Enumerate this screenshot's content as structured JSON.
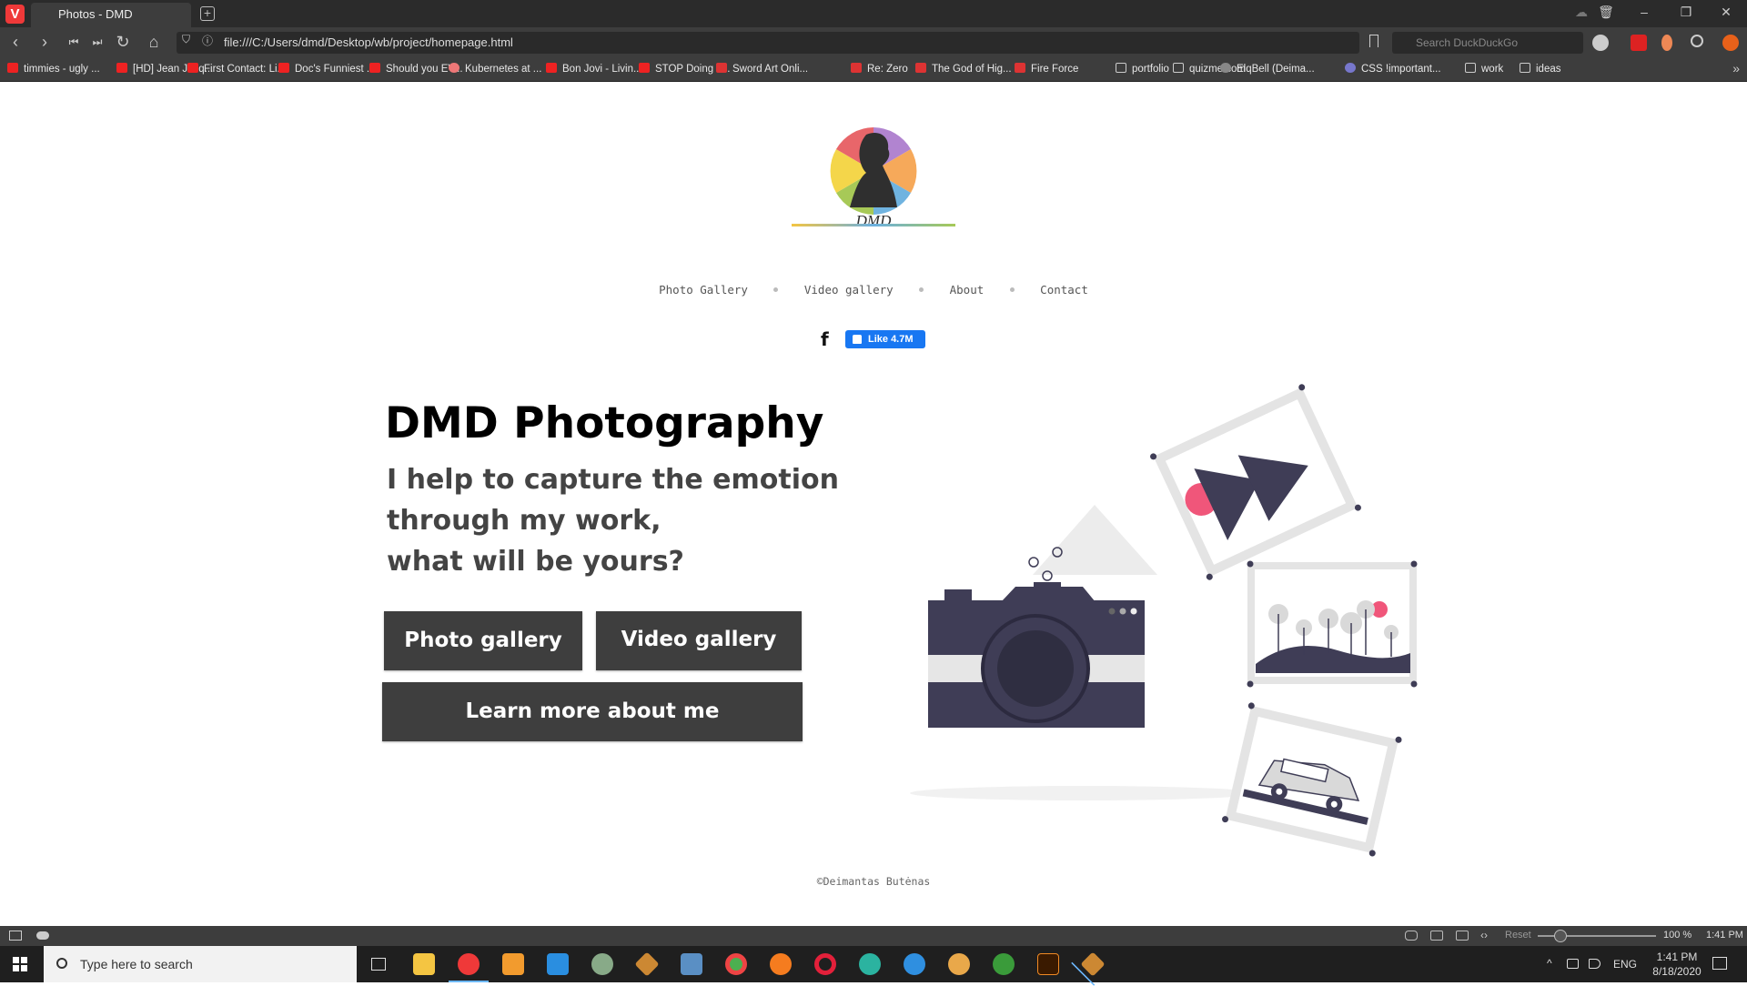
{
  "browser": {
    "tab_title": "Photos - DMD",
    "url": "file:///C:/Users/dmd/Desktop/wb/project/homepage.html",
    "search_placeholder": "Search DuckDuckGo",
    "bookmarks": [
      {
        "label": "timmies - ugly ...",
        "icon": "youtube-icon"
      },
      {
        "label": "[HD] Jean Jacq...",
        "icon": "youtube-icon"
      },
      {
        "label": "First Contact: Li...",
        "icon": "youtube-icon"
      },
      {
        "label": "Doc's Funniest ...",
        "icon": "youtube-icon"
      },
      {
        "label": "Should you EV...",
        "icon": "youtube-icon"
      },
      {
        "label": "Kubernetes at ...",
        "icon": "site-icon"
      },
      {
        "label": "Bon Jovi - Livin...",
        "icon": "youtube-icon"
      },
      {
        "label": "STOP Doing T...",
        "icon": "youtube-icon"
      },
      {
        "label": "Sword Art Onli...",
        "icon": "date-icon"
      },
      {
        "label": "Re: Zero",
        "icon": "date-icon"
      },
      {
        "label": "The God of Hig...",
        "icon": "date-icon"
      },
      {
        "label": "Fire Force",
        "icon": "date-icon"
      },
      {
        "label": "portfolio",
        "icon": "folder-icon"
      },
      {
        "label": "quizme.com",
        "icon": "folder-icon"
      },
      {
        "label": "ElqBell (Deima...",
        "icon": "github-icon"
      },
      {
        "label": "CSS !important...",
        "icon": "css-icon"
      },
      {
        "label": "work",
        "icon": "folder-icon"
      },
      {
        "label": "ideas",
        "icon": "folder-icon"
      }
    ]
  },
  "site": {
    "nav": [
      "Photo Gallery",
      "Video gallery",
      "About",
      "Contact"
    ],
    "fb_glyph": "f",
    "like_label": "Like 4.7M",
    "hero_title": "DMD Photography",
    "hero_tagline": [
      "I help to capture the emotion",
      "through my work,",
      "what will be yours?"
    ],
    "buttons": {
      "photo_gallery": "Photo gallery",
      "video_gallery": "Video gallery",
      "learn_more": "Learn more about me"
    },
    "footer": "©Deimantas Butėnas"
  },
  "statusbar": {
    "reset_label": "Reset",
    "zoom": "100 %",
    "clock": "1:41 PM"
  },
  "taskbar": {
    "search_placeholder": "Type here to search",
    "lang": "ENG",
    "time": "1:41 PM",
    "date": "8/18/2020"
  },
  "colors": {
    "button_bg": "#3e3e3e",
    "fb_blue": "#1877f2",
    "illustration_dark": "#3f3d56",
    "illustration_accent": "#f0567a"
  }
}
